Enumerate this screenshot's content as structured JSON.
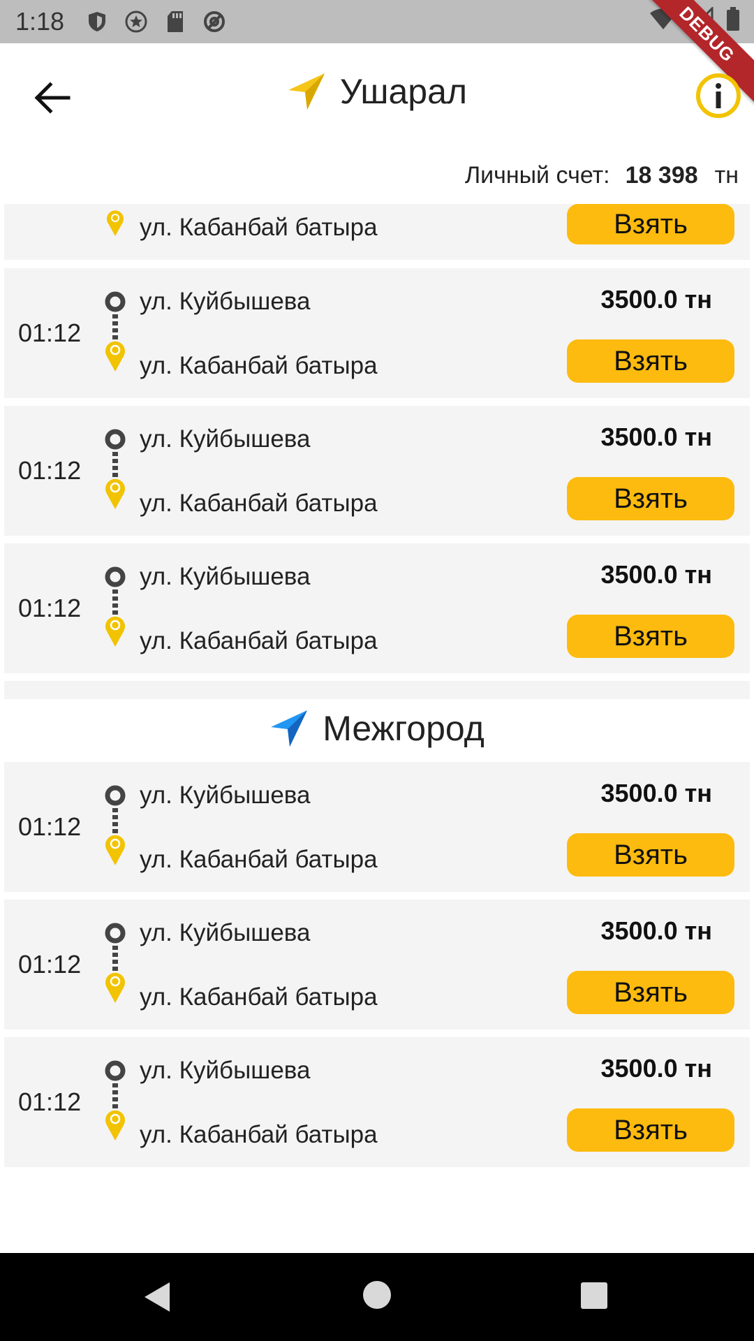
{
  "status_bar": {
    "time": "1:18",
    "debug_label": "DEBUG"
  },
  "app_bar": {
    "title": "Ушарал"
  },
  "balance": {
    "label": "Личный счет:",
    "amount": "18 398",
    "currency": "тн"
  },
  "colors": {
    "accent": "#fdbb0f",
    "card_bg": "#f4f4f4",
    "city_arrow": "#f5c518",
    "intercity_arrow": "#2196f3"
  },
  "partial_card": {
    "to": "ул. Кабанбай батыра",
    "take_label": "Взять"
  },
  "orders": [
    {
      "time": "01:12",
      "from": "ул. Куйбышева",
      "to": "ул. Кабанбай батыра",
      "price": "3500.0 тн",
      "take_label": "Взять"
    },
    {
      "time": "01:12",
      "from": "ул. Куйбышева",
      "to": "ул. Кабанбай батыра",
      "price": "3500.0 тн",
      "take_label": "Взять"
    },
    {
      "time": "01:12",
      "from": "ул. Куйбышева",
      "to": "ул. Кабанбай батыра",
      "price": "3500.0 тн",
      "take_label": "Взять"
    }
  ],
  "intercity": {
    "title": "Межгород",
    "orders": [
      {
        "time": "01:12",
        "from": "ул. Куйбышева",
        "to": "ул. Кабанбай батыра",
        "price": "3500.0 тн",
        "take_label": "Взять"
      },
      {
        "time": "01:12",
        "from": "ул. Куйбышева",
        "to": "ул. Кабанбай батыра",
        "price": "3500.0 тн",
        "take_label": "Взять"
      },
      {
        "time": "01:12",
        "from": "ул. Куйбышева",
        "to": "ул. Кабанбай батыра",
        "price": "3500.0 тн",
        "take_label": "Взять"
      }
    ]
  }
}
